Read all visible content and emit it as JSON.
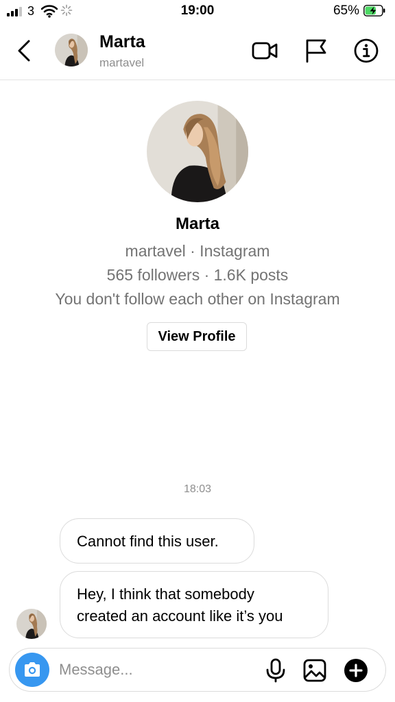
{
  "status_bar": {
    "carrier": "3",
    "time": "19:00",
    "battery_percent": "65%",
    "battery_level": 0.65
  },
  "header": {
    "name": "Marta",
    "username": "martavel",
    "icons": [
      "back-arrow-icon",
      "video-call-icon",
      "flag-icon",
      "info-icon"
    ]
  },
  "profile": {
    "name": "Marta",
    "subtitle": "martavel · Instagram",
    "stats": "565 followers · 1.6K posts",
    "follow_status": "You don't follow each other on Instagram",
    "view_profile_label": "View Profile"
  },
  "conversation": {
    "timestamp": "18:03",
    "messages": [
      {
        "lines": [
          "Cannot find this user."
        ]
      },
      {
        "lines": [
          "Hey, I think that somebody",
          "created an account like it’s you"
        ]
      }
    ]
  },
  "composer": {
    "placeholder": "Message...",
    "icons": [
      "camera-icon",
      "microphone-icon",
      "gallery-icon",
      "plus-icon"
    ]
  },
  "colors": {
    "accent": "#3797f0",
    "secondary_text": "#8e8e8e",
    "border": "#dbdbdb",
    "battery_green": "#4cd964"
  }
}
